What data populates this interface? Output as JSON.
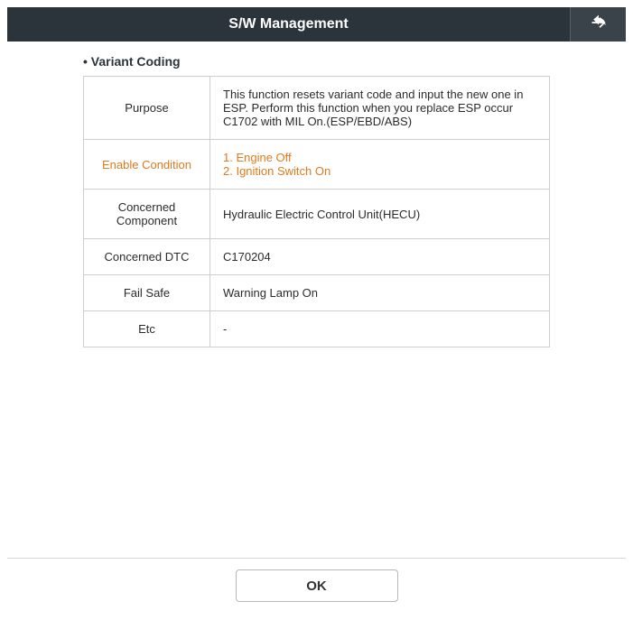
{
  "header": {
    "title": "S/W Management"
  },
  "section": {
    "label": "• Variant Coding"
  },
  "rows": {
    "purpose": {
      "label": "Purpose",
      "value": "This function resets variant code and input the new one in ESP. Perform this function when you replace ESP occur C1702 with MIL On.(ESP/EBD/ABS)"
    },
    "enable_condition": {
      "label": "Enable Condition",
      "line1": "1. Engine Off",
      "line2": "2. Ignition Switch On"
    },
    "concerned_component": {
      "label": "Concerned Component",
      "value": "Hydraulic Electric Control Unit(HECU)"
    },
    "concerned_dtc": {
      "label": "Concerned DTC",
      "value": "C170204"
    },
    "fail_safe": {
      "label": "Fail Safe",
      "value": "Warning Lamp On"
    },
    "etc": {
      "label": "Etc",
      "value": "-"
    }
  },
  "footer": {
    "ok_label": "OK"
  }
}
